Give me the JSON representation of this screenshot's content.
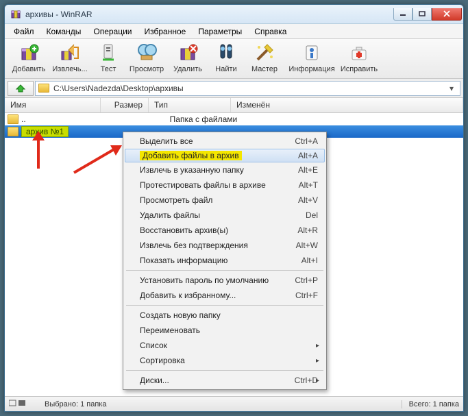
{
  "title": "архивы - WinRAR",
  "menu": [
    "Файл",
    "Команды",
    "Операции",
    "Избранное",
    "Параметры",
    "Справка"
  ],
  "toolbar": [
    {
      "label": "Добавить",
      "icon": "add"
    },
    {
      "label": "Извлечь...",
      "icon": "extract"
    },
    {
      "label": "Тест",
      "icon": "test"
    },
    {
      "label": "Просмотр",
      "icon": "view"
    },
    {
      "label": "Удалить",
      "icon": "delete"
    },
    {
      "label": "Найти",
      "icon": "find"
    },
    {
      "label": "Мастер",
      "icon": "wizard"
    },
    {
      "label": "Информация",
      "icon": "info"
    },
    {
      "label": "Исправить",
      "icon": "repair"
    }
  ],
  "path": "C:\\Users\\Nadezda\\Desktop\\архивы",
  "columns": {
    "name": "Имя",
    "size": "Размер",
    "type": "Тип",
    "modified": "Изменён"
  },
  "rows": {
    "parent": {
      "name": "..",
      "type": "Папка с файлами"
    },
    "selected": {
      "name": "архив №1"
    }
  },
  "context": {
    "items": [
      {
        "label": "Выделить все",
        "shortcut": "Ctrl+A"
      },
      {
        "label": "Добавить файлы в архив",
        "shortcut": "Alt+A",
        "hover": true
      },
      {
        "label": "Извлечь в указанную папку",
        "shortcut": "Alt+E"
      },
      {
        "label": "Протестировать файлы в архиве",
        "shortcut": "Alt+T"
      },
      {
        "label": "Просмотреть файл",
        "shortcut": "Alt+V"
      },
      {
        "label": "Удалить файлы",
        "shortcut": "Del"
      },
      {
        "label": "Восстановить архив(ы)",
        "shortcut": "Alt+R"
      },
      {
        "label": "Извлечь без подтверждения",
        "shortcut": "Alt+W"
      },
      {
        "label": "Показать информацию",
        "shortcut": "Alt+I"
      },
      {
        "sep": true
      },
      {
        "label": "Установить пароль по умолчанию",
        "shortcut": "Ctrl+P"
      },
      {
        "label": "Добавить к избранному...",
        "shortcut": "Ctrl+F"
      },
      {
        "sep": true
      },
      {
        "label": "Создать новую папку"
      },
      {
        "label": "Переименовать"
      },
      {
        "label": "Список",
        "sub": true
      },
      {
        "label": "Сортировка",
        "sub": true
      },
      {
        "sep": true
      },
      {
        "label": "Диски...",
        "shortcut": "Ctrl+D",
        "sub": true
      }
    ]
  },
  "status": {
    "selected": "Выбрано: 1 папка",
    "total": "Всего: 1 папка"
  }
}
